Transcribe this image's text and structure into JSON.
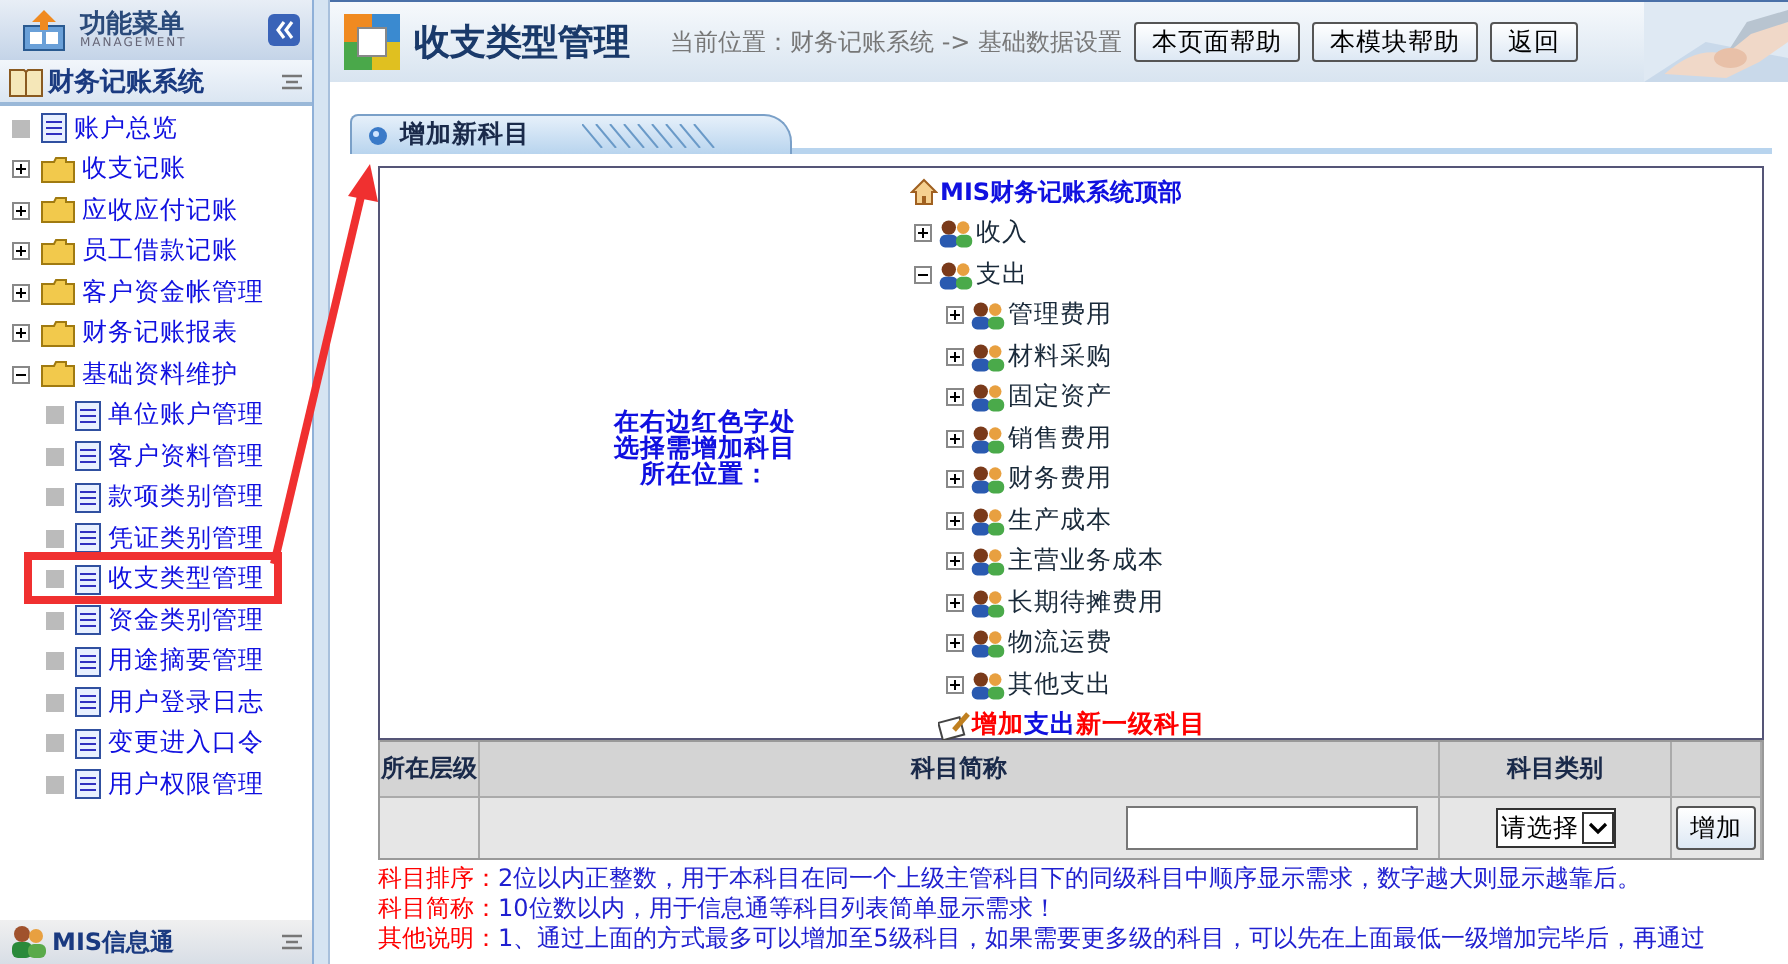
{
  "sidebar": {
    "title": "功能菜单",
    "subtitle": "MANAGEMENT",
    "system_title": "财务记账系统",
    "items": [
      {
        "label": "账户总览",
        "kind": "page"
      },
      {
        "label": "收支记账",
        "kind": "folder",
        "expanded": false
      },
      {
        "label": "应收应付记账",
        "kind": "folder",
        "expanded": false
      },
      {
        "label": "员工借款记账",
        "kind": "folder",
        "expanded": false
      },
      {
        "label": "客户资金帐管理",
        "kind": "folder",
        "expanded": false
      },
      {
        "label": "财务记账报表",
        "kind": "folder",
        "expanded": false
      },
      {
        "label": "基础资料维护",
        "kind": "folder",
        "expanded": true,
        "children": [
          {
            "label": "单位账户管理",
            "kind": "page"
          },
          {
            "label": "客户资料管理",
            "kind": "page"
          },
          {
            "label": "款项类别管理",
            "kind": "page"
          },
          {
            "label": "凭证类别管理",
            "kind": "page"
          },
          {
            "label": "收支类型管理",
            "kind": "page"
          },
          {
            "label": "资金类别管理",
            "kind": "page"
          },
          {
            "label": "用途摘要管理",
            "kind": "page"
          },
          {
            "label": "用户登录日志",
            "kind": "page"
          },
          {
            "label": "变更进入口令",
            "kind": "page"
          },
          {
            "label": "用户权限管理",
            "kind": "page"
          }
        ]
      }
    ],
    "footer": "MIS信息通"
  },
  "header": {
    "title": "收支类型管理",
    "breadcrumb": "当前位置：财务记账系统 -> 基础数据设置",
    "buttons": [
      "本页面帮助",
      "本模块帮助",
      "返回"
    ]
  },
  "panel": {
    "tab": "增加新科目",
    "instruction": [
      "在右边红色字处",
      "选择需增加科目",
      "所在位置："
    ],
    "tree": {
      "root": "MIS财务记账系统顶部",
      "children": [
        {
          "label": "收入",
          "expanded": false
        },
        {
          "label": "支出",
          "expanded": true,
          "children": [
            {
              "label": "管理费用",
              "expanded": false
            },
            {
              "label": "材料采购",
              "expanded": false
            },
            {
              "label": "固定资产",
              "expanded": false
            },
            {
              "label": "销售费用",
              "expanded": false
            },
            {
              "label": "财务费用",
              "expanded": false
            },
            {
              "label": "生产成本",
              "expanded": false
            },
            {
              "label": "主营业务成本",
              "expanded": false
            },
            {
              "label": "长期待摊费用",
              "expanded": false
            },
            {
              "label": "物流运费",
              "expanded": false
            },
            {
              "label": "其他支出",
              "expanded": false
            }
          ],
          "add_link": {
            "action": "增加",
            "parent": "支出",
            "suffix": "新一级科目"
          }
        }
      ]
    }
  },
  "form": {
    "columns": [
      "所在层级",
      "科目简称",
      "科目类别"
    ],
    "select": "请选择",
    "button": "增加"
  },
  "notes": [
    {
      "label": "科目排序：",
      "text": "2位以内正整数，用于本科目在同一个上级主管科目下的同级科目中顺序显示需求，数字越大则显示越靠后。"
    },
    {
      "label": "科目简称：",
      "text": "10位数以内，用于信息通等科目列表简单显示需求！"
    },
    {
      "label": "其他说明：",
      "text": "1、通过上面的方式最多可以增加至5级科目，如果需要更多级的科目，可以先在上面最低一级增加完毕后，再通过"
    }
  ]
}
